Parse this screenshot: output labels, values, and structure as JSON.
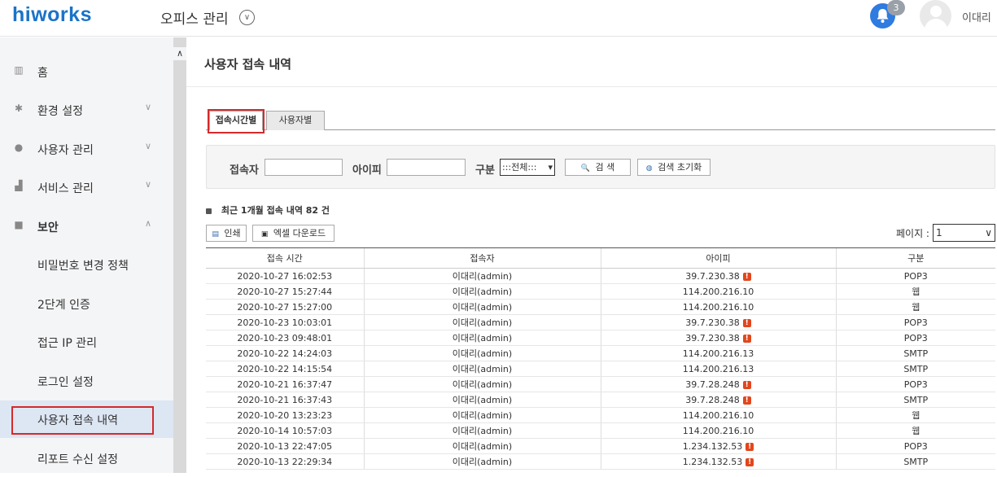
{
  "header": {
    "logo": "hiworks",
    "office_title": "오피스 관리",
    "notification_count": "3",
    "user_name": "이대리"
  },
  "sidebar": {
    "items": [
      {
        "label": "홈",
        "icon": "building-icon"
      },
      {
        "label": "환경 설정",
        "icon": "gear-icon"
      },
      {
        "label": "사용자 관리",
        "icon": "user-icon"
      },
      {
        "label": "서비스 관리",
        "icon": "chart-icon"
      },
      {
        "label": "보안",
        "icon": "lock-icon"
      }
    ],
    "security_subitems": [
      {
        "label": "비밀번호 변경 정책"
      },
      {
        "label": "2단계 인증"
      },
      {
        "label": "접근 IP 관리"
      },
      {
        "label": "로그인 설정"
      },
      {
        "label": "사용자 접속 내역"
      },
      {
        "label": "리포트 수신 설정"
      }
    ]
  },
  "main": {
    "title": "사용자 접속 내역",
    "tabs": [
      {
        "label": "접속시간별"
      },
      {
        "label": "사용자별"
      }
    ],
    "search": {
      "user_label": "접속자",
      "ip_label": "아이피",
      "type_label": "구분",
      "type_selected": ":::전체:::",
      "search_button": "검 색",
      "reset_button": "검색 초기화"
    },
    "summary": "최근 1개월 접속 내역 82 건",
    "print_button": "인쇄",
    "excel_button": "엑셀 다운로드",
    "page_label": "페이지 :",
    "page_selected": "1",
    "table": {
      "columns": [
        "접속 시간",
        "접속자",
        "아이피",
        "구분"
      ],
      "rows": [
        {
          "time": "2020-10-27 16:02:53",
          "user": "이대리(admin)",
          "ip": "39.7.230.38",
          "warn": true,
          "type": "POP3"
        },
        {
          "time": "2020-10-27 15:27:44",
          "user": "이대리(admin)",
          "ip": "114.200.216.10",
          "warn": false,
          "type": "웹"
        },
        {
          "time": "2020-10-27 15:27:00",
          "user": "이대리(admin)",
          "ip": "114.200.216.10",
          "warn": false,
          "type": "웹"
        },
        {
          "time": "2020-10-23 10:03:01",
          "user": "이대리(admin)",
          "ip": "39.7.230.38",
          "warn": true,
          "type": "POP3"
        },
        {
          "time": "2020-10-23 09:48:01",
          "user": "이대리(admin)",
          "ip": "39.7.230.38",
          "warn": true,
          "type": "POP3"
        },
        {
          "time": "2020-10-22 14:24:03",
          "user": "이대리(admin)",
          "ip": "114.200.216.13",
          "warn": false,
          "type": "SMTP"
        },
        {
          "time": "2020-10-22 14:15:54",
          "user": "이대리(admin)",
          "ip": "114.200.216.13",
          "warn": false,
          "type": "SMTP"
        },
        {
          "time": "2020-10-21 16:37:47",
          "user": "이대리(admin)",
          "ip": "39.7.28.248",
          "warn": true,
          "type": "POP3"
        },
        {
          "time": "2020-10-21 16:37:43",
          "user": "이대리(admin)",
          "ip": "39.7.28.248",
          "warn": true,
          "type": "SMTP"
        },
        {
          "time": "2020-10-20 13:23:23",
          "user": "이대리(admin)",
          "ip": "114.200.216.10",
          "warn": false,
          "type": "웹"
        },
        {
          "time": "2020-10-14 10:57:03",
          "user": "이대리(admin)",
          "ip": "114.200.216.10",
          "warn": false,
          "type": "웹"
        },
        {
          "time": "2020-10-13 22:47:05",
          "user": "이대리(admin)",
          "ip": "1.234.132.53",
          "warn": true,
          "type": "POP3"
        },
        {
          "time": "2020-10-13 22:29:34",
          "user": "이대리(admin)",
          "ip": "1.234.132.53",
          "warn": true,
          "type": "SMTP"
        }
      ]
    }
  }
}
